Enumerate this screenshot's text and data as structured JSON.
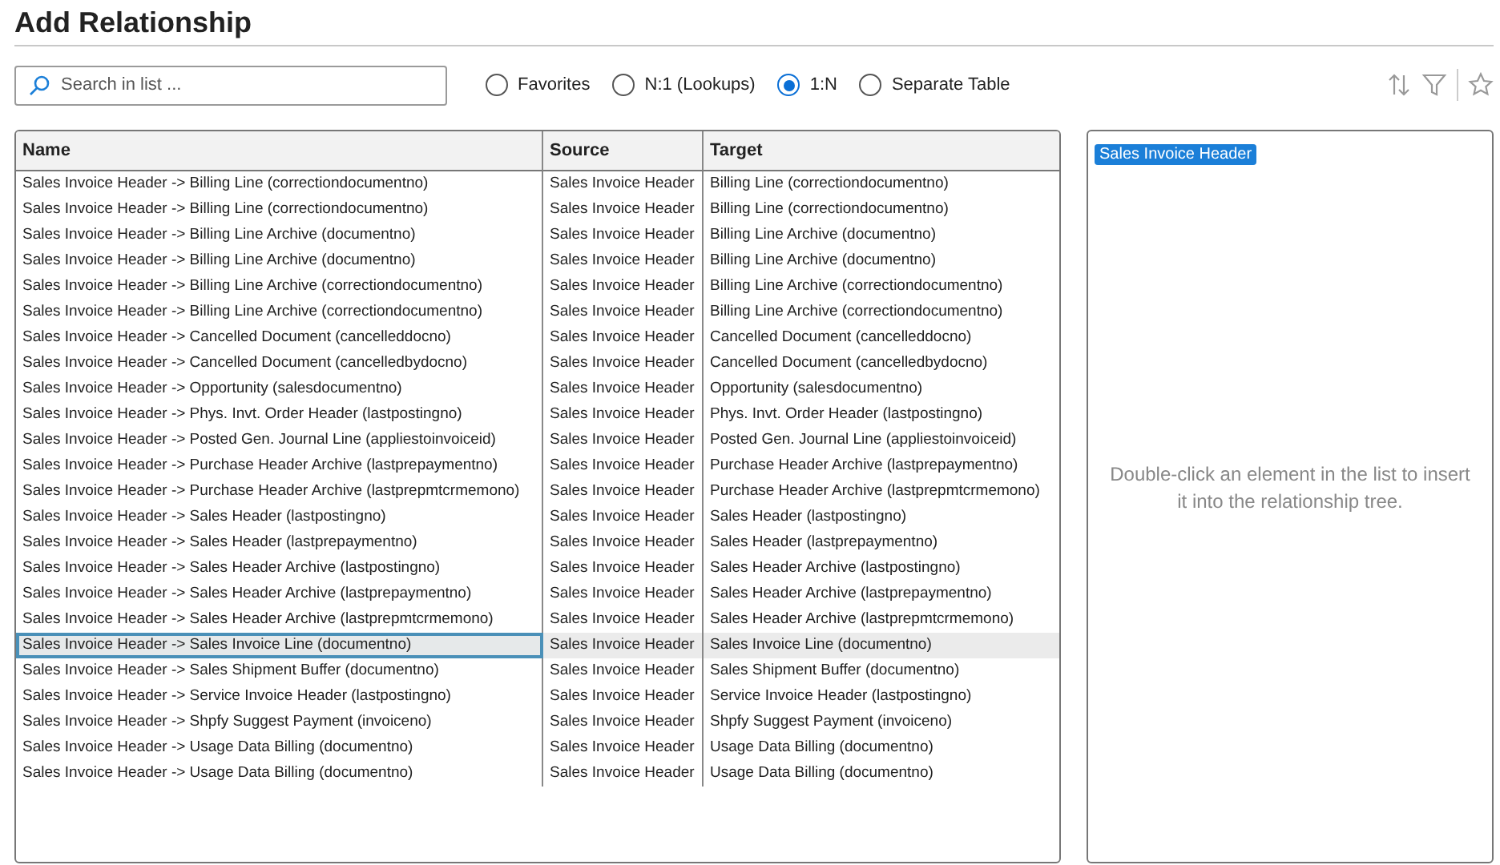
{
  "title": "Add Relationship",
  "search": {
    "placeholder": "Search in list ..."
  },
  "filters": [
    {
      "label": "Favorites",
      "selected": false
    },
    {
      "label": "N:1 (Lookups)",
      "selected": false
    },
    {
      "label": "1:N",
      "selected": true
    },
    {
      "label": "Separate Table",
      "selected": false
    }
  ],
  "table": {
    "columns": [
      "Name",
      "Source",
      "Target"
    ],
    "rows": [
      {
        "name": "Sales Invoice Header -> Billing Line (correctiondocumentno)",
        "source": "Sales Invoice Header",
        "target": "Billing Line (correctiondocumentno)",
        "selected": false
      },
      {
        "name": "Sales Invoice Header -> Billing Line (correctiondocumentno)",
        "source": "Sales Invoice Header",
        "target": "Billing Line (correctiondocumentno)",
        "selected": false
      },
      {
        "name": "Sales Invoice Header -> Billing Line Archive (documentno)",
        "source": "Sales Invoice Header",
        "target": "Billing Line Archive (documentno)",
        "selected": false
      },
      {
        "name": "Sales Invoice Header -> Billing Line Archive (documentno)",
        "source": "Sales Invoice Header",
        "target": "Billing Line Archive (documentno)",
        "selected": false
      },
      {
        "name": "Sales Invoice Header -> Billing Line Archive (correctiondocumentno)",
        "source": "Sales Invoice Header",
        "target": "Billing Line Archive (correctiondocumentno)",
        "selected": false
      },
      {
        "name": "Sales Invoice Header -> Billing Line Archive (correctiondocumentno)",
        "source": "Sales Invoice Header",
        "target": "Billing Line Archive (correctiondocumentno)",
        "selected": false
      },
      {
        "name": "Sales Invoice Header -> Cancelled Document (cancelleddocno)",
        "source": "Sales Invoice Header",
        "target": "Cancelled Document (cancelleddocno)",
        "selected": false
      },
      {
        "name": "Sales Invoice Header -> Cancelled Document (cancelledbydocno)",
        "source": "Sales Invoice Header",
        "target": "Cancelled Document (cancelledbydocno)",
        "selected": false
      },
      {
        "name": "Sales Invoice Header -> Opportunity (salesdocumentno)",
        "source": "Sales Invoice Header",
        "target": "Opportunity (salesdocumentno)",
        "selected": false
      },
      {
        "name": "Sales Invoice Header -> Phys. Invt. Order Header (lastpostingno)",
        "source": "Sales Invoice Header",
        "target": "Phys. Invt. Order Header (lastpostingno)",
        "selected": false
      },
      {
        "name": "Sales Invoice Header -> Posted Gen. Journal Line (appliestoinvoiceid)",
        "source": "Sales Invoice Header",
        "target": "Posted Gen. Journal Line (appliestoinvoiceid)",
        "selected": false
      },
      {
        "name": "Sales Invoice Header -> Purchase Header Archive (lastprepaymentno)",
        "source": "Sales Invoice Header",
        "target": "Purchase Header Archive (lastprepaymentno)",
        "selected": false
      },
      {
        "name": "Sales Invoice Header -> Purchase Header Archive (lastprepmtcrmemono)",
        "source": "Sales Invoice Header",
        "target": "Purchase Header Archive (lastprepmtcrmemono)",
        "selected": false
      },
      {
        "name": "Sales Invoice Header -> Sales Header (lastpostingno)",
        "source": "Sales Invoice Header",
        "target": "Sales Header (lastpostingno)",
        "selected": false
      },
      {
        "name": "Sales Invoice Header -> Sales Header (lastprepaymentno)",
        "source": "Sales Invoice Header",
        "target": "Sales Header (lastprepaymentno)",
        "selected": false
      },
      {
        "name": "Sales Invoice Header -> Sales Header Archive (lastpostingno)",
        "source": "Sales Invoice Header",
        "target": "Sales Header Archive (lastpostingno)",
        "selected": false
      },
      {
        "name": "Sales Invoice Header -> Sales Header Archive (lastprepaymentno)",
        "source": "Sales Invoice Header",
        "target": "Sales Header Archive (lastprepaymentno)",
        "selected": false
      },
      {
        "name": "Sales Invoice Header -> Sales Header Archive (lastprepmtcrmemono)",
        "source": "Sales Invoice Header",
        "target": "Sales Header Archive (lastprepmtcrmemono)",
        "selected": false
      },
      {
        "name": "Sales Invoice Header -> Sales Invoice Line (documentno)",
        "source": "Sales Invoice Header",
        "target": "Sales Invoice Line (documentno)",
        "selected": true
      },
      {
        "name": "Sales Invoice Header -> Sales Shipment Buffer (documentno)",
        "source": "Sales Invoice Header",
        "target": "Sales Shipment Buffer (documentno)",
        "selected": false
      },
      {
        "name": "Sales Invoice Header -> Service Invoice Header (lastpostingno)",
        "source": "Sales Invoice Header",
        "target": "Service Invoice Header (lastpostingno)",
        "selected": false
      },
      {
        "name": "Sales Invoice Header -> Shpfy Suggest Payment (invoiceno)",
        "source": "Sales Invoice Header",
        "target": "Shpfy Suggest Payment (invoiceno)",
        "selected": false
      },
      {
        "name": "Sales Invoice Header -> Usage Data Billing (documentno)",
        "source": "Sales Invoice Header",
        "target": "Usage Data Billing (documentno)",
        "selected": false
      },
      {
        "name": "Sales Invoice Header -> Usage Data Billing (documentno)",
        "source": "Sales Invoice Header",
        "target": "Usage Data Billing (documentno)",
        "selected": false
      }
    ]
  },
  "tree": {
    "root": "Sales Invoice Header",
    "hint": "Double-click an element in the list to insert it into the relationship tree."
  }
}
